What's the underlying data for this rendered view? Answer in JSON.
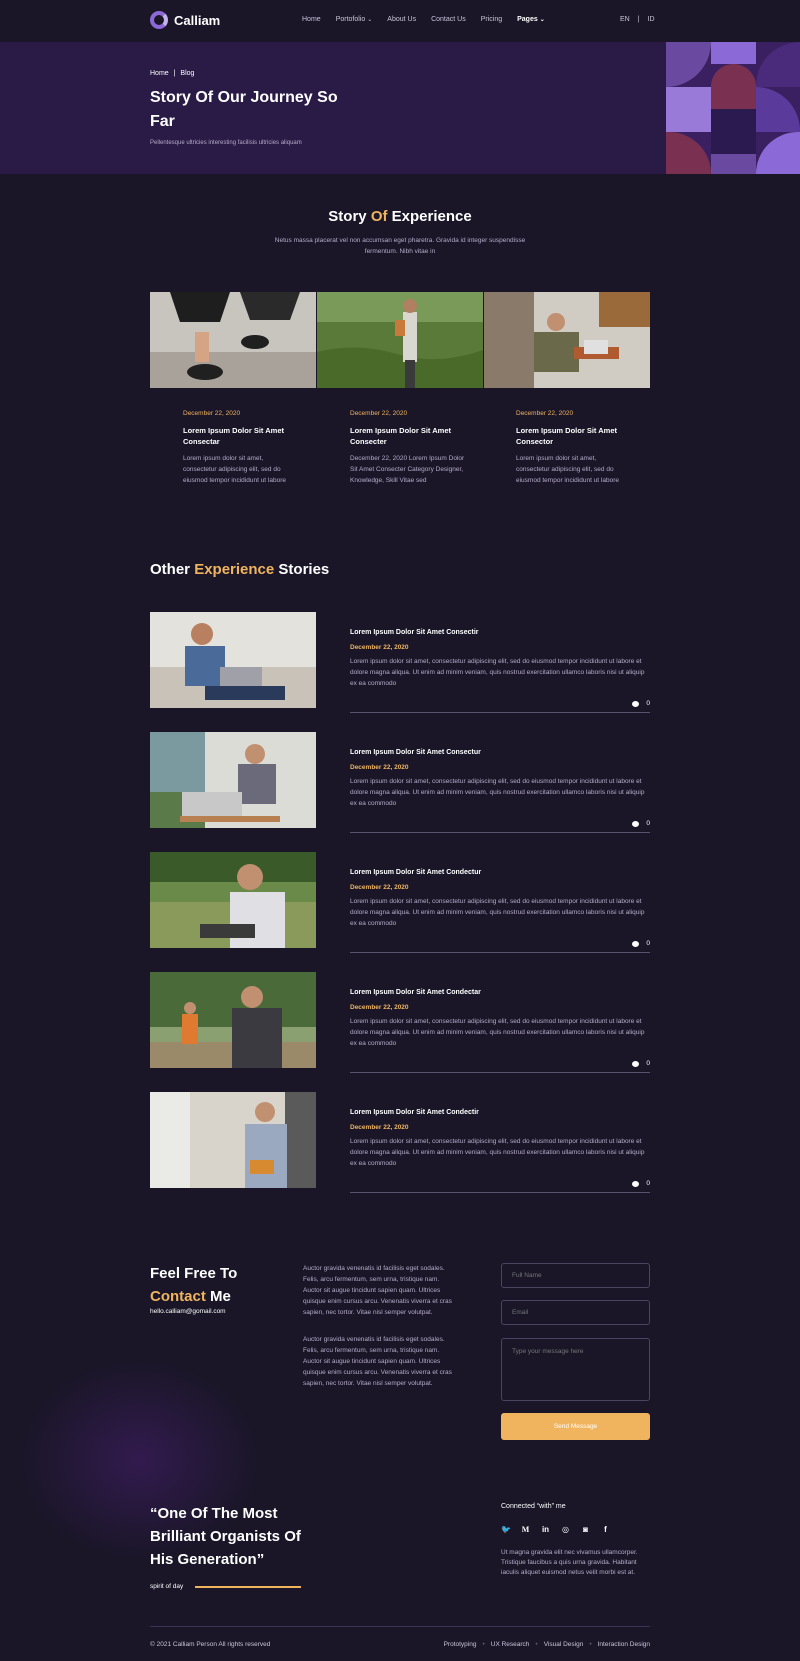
{
  "nav": {
    "brand": "Calliam",
    "items": [
      "Home",
      "Portofolio",
      "About Us",
      "Contact Us",
      "Pricing",
      "Pages"
    ],
    "lang_en": "EN",
    "lang_sep": "|",
    "lang_id": "ID"
  },
  "hero": {
    "crumb_home": "Home",
    "crumb_sep": "|",
    "crumb_blog": "Blog",
    "title": "Story Of Our Journey So Far",
    "subtitle": "Pellentesque ultricies interesting facilisis ultricies aliquam"
  },
  "story": {
    "title_a": "Story ",
    "title_b": "Of",
    "title_c": " Experience",
    "subtitle": "Netus massa placerat vel non accumsan eget pharetra. Gravida id integer suspendisse fermentum. Nibh vitae in",
    "cards": [
      {
        "date": "December 22, 2020",
        "title": "Lorem Ipsum Dolor Sit Amet Consectar",
        "text": "Lorem ipsum dolor sit amet, consectetur adipiscing elit, sed do eiusmod tempor incididunt ut labore"
      },
      {
        "date": "December 22, 2020",
        "title": "Lorem Ipsum Dolor Sit Amet Consecter",
        "text": "December 22, 2020 Lorem Ipsum Dolor Sit Amet Consecter Category Designer, Knowledge, Skill Vitae sed"
      },
      {
        "date": "December 22, 2020",
        "title": "Lorem Ipsum Dolor Sit Amet Consector",
        "text": "Lorem ipsum dolor sit amet, consectetur adipiscing elit, sed do eiusmod tempor incididunt ut labore"
      }
    ]
  },
  "other": {
    "title_a": "Other ",
    "title_b": "Experience",
    "title_c": " Stories",
    "stories": [
      {
        "title": "Lorem Ipsum Dolor Sit Amet Consectir",
        "date": "December 22, 2020",
        "text": "Lorem ipsum dolor sit amet, consectetur adipiscing elit, sed do eiusmod tempor incididunt ut labore et dolore magna aliqua. Ut enim ad minim veniam, quis nostrud exercitation ullamco laboris nisi ut aliquip ex ea commodo",
        "comments": "0"
      },
      {
        "title": "Lorem Ipsum Dolor Sit Amet Consectur",
        "date": "December 22, 2020",
        "text": "Lorem ipsum dolor sit amet, consectetur adipiscing elit, sed do eiusmod tempor incididunt ut labore et dolore magna aliqua. Ut enim ad minim veniam, quis nostrud exercitation ullamco laboris nisi ut aliquip ex ea commodo",
        "comments": "0"
      },
      {
        "title": "Lorem Ipsum Dolor Sit Amet Condectur",
        "date": "December 22, 2020",
        "text": "Lorem ipsum dolor sit amet, consectetur adipiscing elit, sed do eiusmod tempor incididunt ut labore et dolore magna aliqua. Ut enim ad minim veniam, quis nostrud exercitation ullamco laboris nisi ut aliquip ex ea commodo",
        "comments": "0"
      },
      {
        "title": "Lorem Ipsum Dolor Sit Amet Condectar",
        "date": "December 22, 2020",
        "text": "Lorem ipsum dolor sit amet, consectetur adipiscing elit, sed do eiusmod tempor incididunt ut labore et dolore magna aliqua. Ut enim ad minim veniam, quis nostrud exercitation ullamco laboris nisi ut aliquip ex ea commodo",
        "comments": "0"
      },
      {
        "title": "Lorem Ipsum Dolor Sit Amet Condectir",
        "date": "December 22, 2020",
        "text": "Lorem ipsum dolor sit amet, consectetur adipiscing elit, sed do eiusmod tempor incididunt ut labore et dolore magna aliqua. Ut enim ad minim veniam, quis nostrud exercitation ullamco laboris nisi ut aliquip ex ea commodo",
        "comments": "0"
      }
    ]
  },
  "contact": {
    "heading_a": "Feel Free To",
    "heading_b": "Contact",
    "heading_c": " Me",
    "email": "hello.calliam@gomail.com",
    "para1": "Auctor gravida venenatis id facilisis eget sodales. Felis, arcu fermentum, sem urna, tristique nam. Auctor sit augue tincidunt sapien quam. Ultrices quisque enim cursus arcu. Venenatis viverra et cras sapien, nec tortor. Vitae nisl semper volutpat.",
    "para2": "Auctor gravida venenatis id facilisis eget sodales. Felis, arcu fermentum, sem urna, tristique nam. Auctor sit augue tincidunt sapien quam. Ultrices quisque enim cursus arcu. Venenatis viverra et cras sapien, nec tortor. Vitae nisl semper volutpat.",
    "name_placeholder": "Full Name",
    "email_placeholder": "Email",
    "message_placeholder": "Type your message here",
    "send_label": "Send Message"
  },
  "quote": {
    "text": "“One Of The Most Brilliant Organists Of His Generation”",
    "attribution": "spirit of day"
  },
  "social": {
    "heading": "Connected “with” me",
    "icons": [
      "twitter-icon",
      "medium-icon",
      "linkedin-icon",
      "dribbble-icon",
      "instagram-icon",
      "facebook-icon"
    ],
    "text": "Ut magna gravida elit nec vivamus ullamcorper. Tristique faucibus a quis urna gravida. Habitant iaculis aliquet euismod netus velit morbi est at."
  },
  "footer": {
    "copyright": "© 2021 Calliam Person All rights reserved",
    "links": [
      "Prototyping",
      "UX Research",
      "Visual Design",
      "Interaction Design"
    ]
  },
  "colors": {
    "background": "#1a1628",
    "hero": "#2a1a46",
    "accent": "#f0b45f",
    "brand": "#8b6ad8"
  }
}
